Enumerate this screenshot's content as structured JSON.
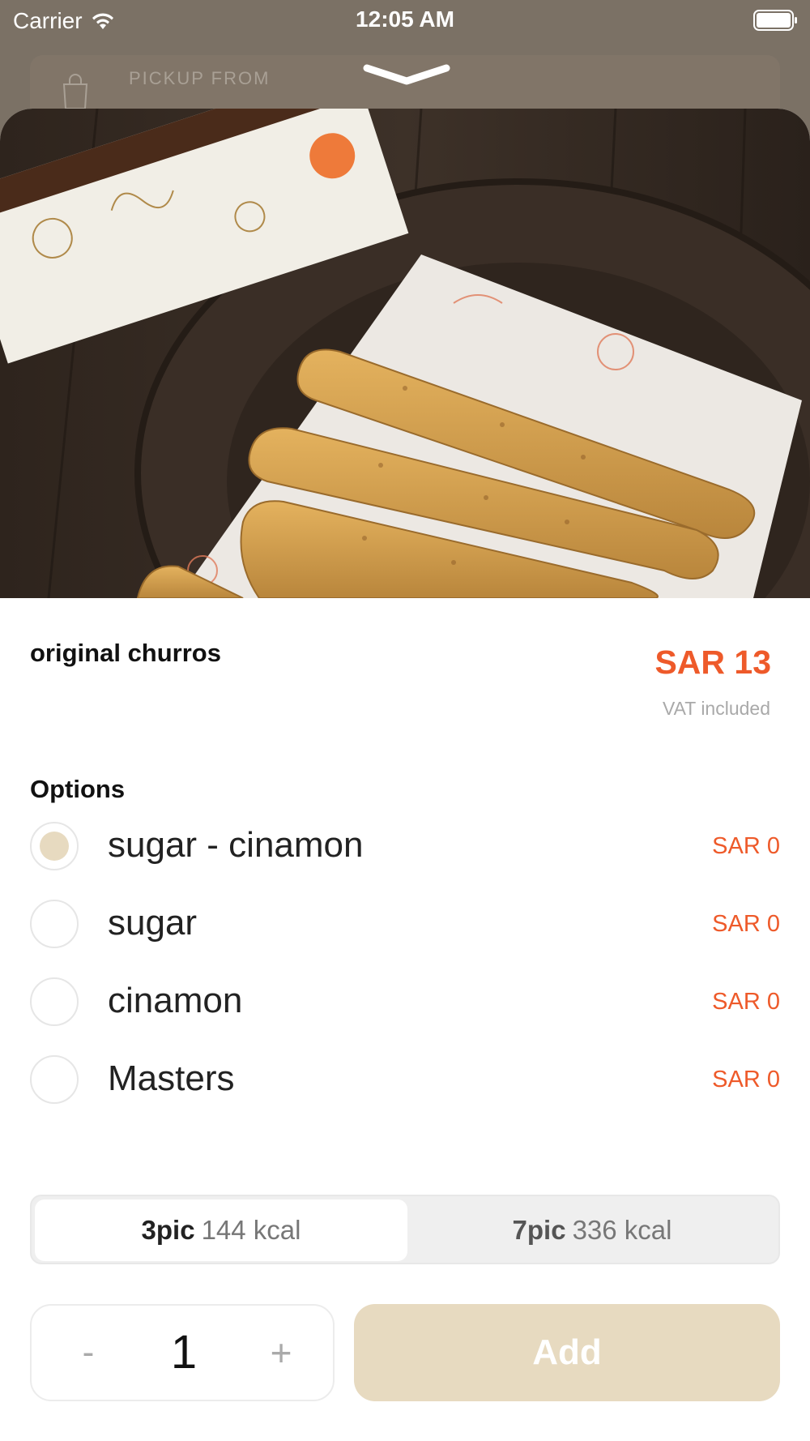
{
  "status_bar": {
    "carrier": "Carrier",
    "time": "12:05 AM"
  },
  "background": {
    "pickup_label": "PICKUP FROM"
  },
  "product": {
    "name": "original churros",
    "price": "SAR 13",
    "vat_note": "VAT included",
    "image_alt": "churros-photo"
  },
  "options": {
    "title": "Options",
    "items": [
      {
        "label": "sugar -  cinamon",
        "price": "SAR 0",
        "selected": true
      },
      {
        "label": "sugar",
        "price": "SAR 0",
        "selected": false
      },
      {
        "label": "cinamon",
        "price": "SAR 0",
        "selected": false
      },
      {
        "label": "Masters",
        "price": "SAR 0",
        "selected": false
      }
    ]
  },
  "sizes": [
    {
      "name": "3pic",
      "kcal": "144 kcal",
      "selected": true
    },
    {
      "name": "7pic",
      "kcal": "336 kcal",
      "selected": false
    }
  ],
  "quantity": {
    "minus": "-",
    "value": "1",
    "plus": "+"
  },
  "add_button": {
    "label": "Add"
  },
  "colors": {
    "accent": "#ee5a2a",
    "beige": "#e7dac0",
    "overlay": "#7b7165"
  }
}
